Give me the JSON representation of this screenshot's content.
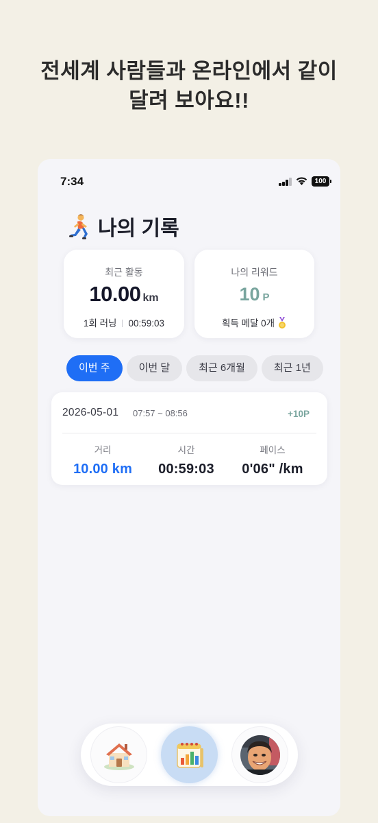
{
  "promo": {
    "line1": "전세계 사람들과 온라인에서 같이",
    "line2": "달려 보아요!!"
  },
  "status_bar": {
    "time": "7:34",
    "battery": "100"
  },
  "header": {
    "title": "나의 기록"
  },
  "activity_card": {
    "label": "최근 활동",
    "distance": "10.00",
    "unit": "km",
    "runs": "1회 러닝",
    "duration": "00:59:03"
  },
  "reward_card": {
    "label": "나의 리워드",
    "points": "10",
    "unit": "P",
    "medals": "획득 메달 0개"
  },
  "tabs": [
    {
      "label": "이번 주",
      "active": true
    },
    {
      "label": "이번 달",
      "active": false
    },
    {
      "label": "최근 6개월",
      "active": false
    },
    {
      "label": "최근 1년",
      "active": false
    }
  ],
  "records": [
    {
      "date": "2026-05-01",
      "time_range": "07:57 ~ 08:56",
      "points": "+10P",
      "distance_label": "거리",
      "distance": "10.00 km",
      "time_label": "시간",
      "time": "00:59:03",
      "pace_label": "페이스",
      "pace": "0'06\" /km"
    }
  ],
  "nav": [
    {
      "icon": "house-icon"
    },
    {
      "icon": "calendar-chart-icon",
      "active": true
    },
    {
      "icon": "avatar-icon"
    }
  ],
  "colors": {
    "accent_blue": "#1f6ef5",
    "reward_green": "#79a59e",
    "background": "#f3f0e6"
  }
}
